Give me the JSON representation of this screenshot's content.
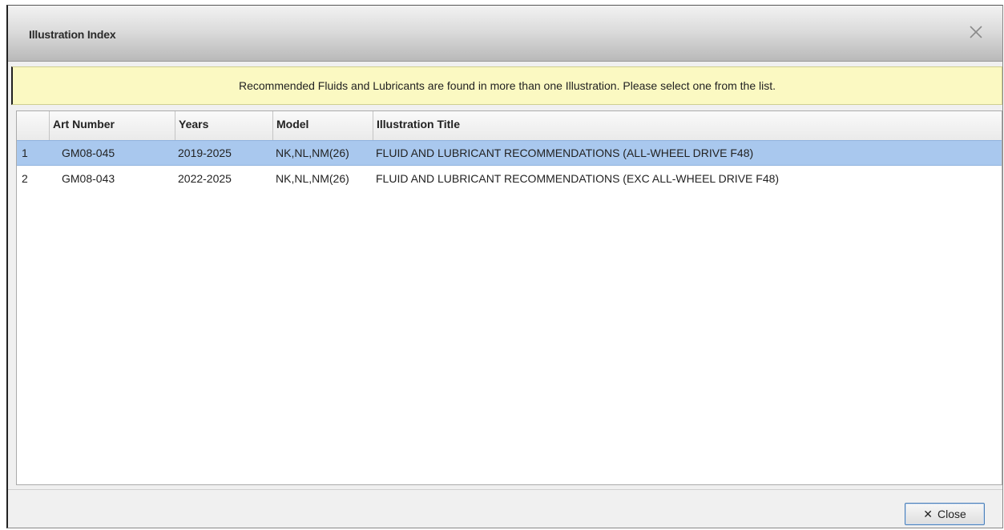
{
  "dialog": {
    "title": "Illustration Index",
    "close_icon": "close-icon"
  },
  "banner": {
    "message": "Recommended Fluids and Lubricants are found in more than one Illustration. Please select one from the list."
  },
  "table": {
    "columns": {
      "index": "",
      "art_number": "Art Number",
      "years": "Years",
      "model": "Model",
      "illustration_title": "Illustration Title"
    },
    "rows": [
      {
        "index": "1",
        "art_number": "GM08-045",
        "years": "2019-2025",
        "model": "NK,NL,NM(26)",
        "illustration_title": "FLUID AND LUBRICANT RECOMMENDATIONS (ALL-WHEEL DRIVE F48)",
        "selected": true
      },
      {
        "index": "2",
        "art_number": "GM08-043",
        "years": "2022-2025",
        "model": "NK,NL,NM(26)",
        "illustration_title": "FLUID AND LUBRICANT RECOMMENDATIONS (EXC ALL-WHEEL DRIVE F48)",
        "selected": false
      }
    ],
    "selected_row_color": "#a9c8ee"
  },
  "footer": {
    "close_button_label": "Close",
    "close_button_icon": "x-icon"
  }
}
